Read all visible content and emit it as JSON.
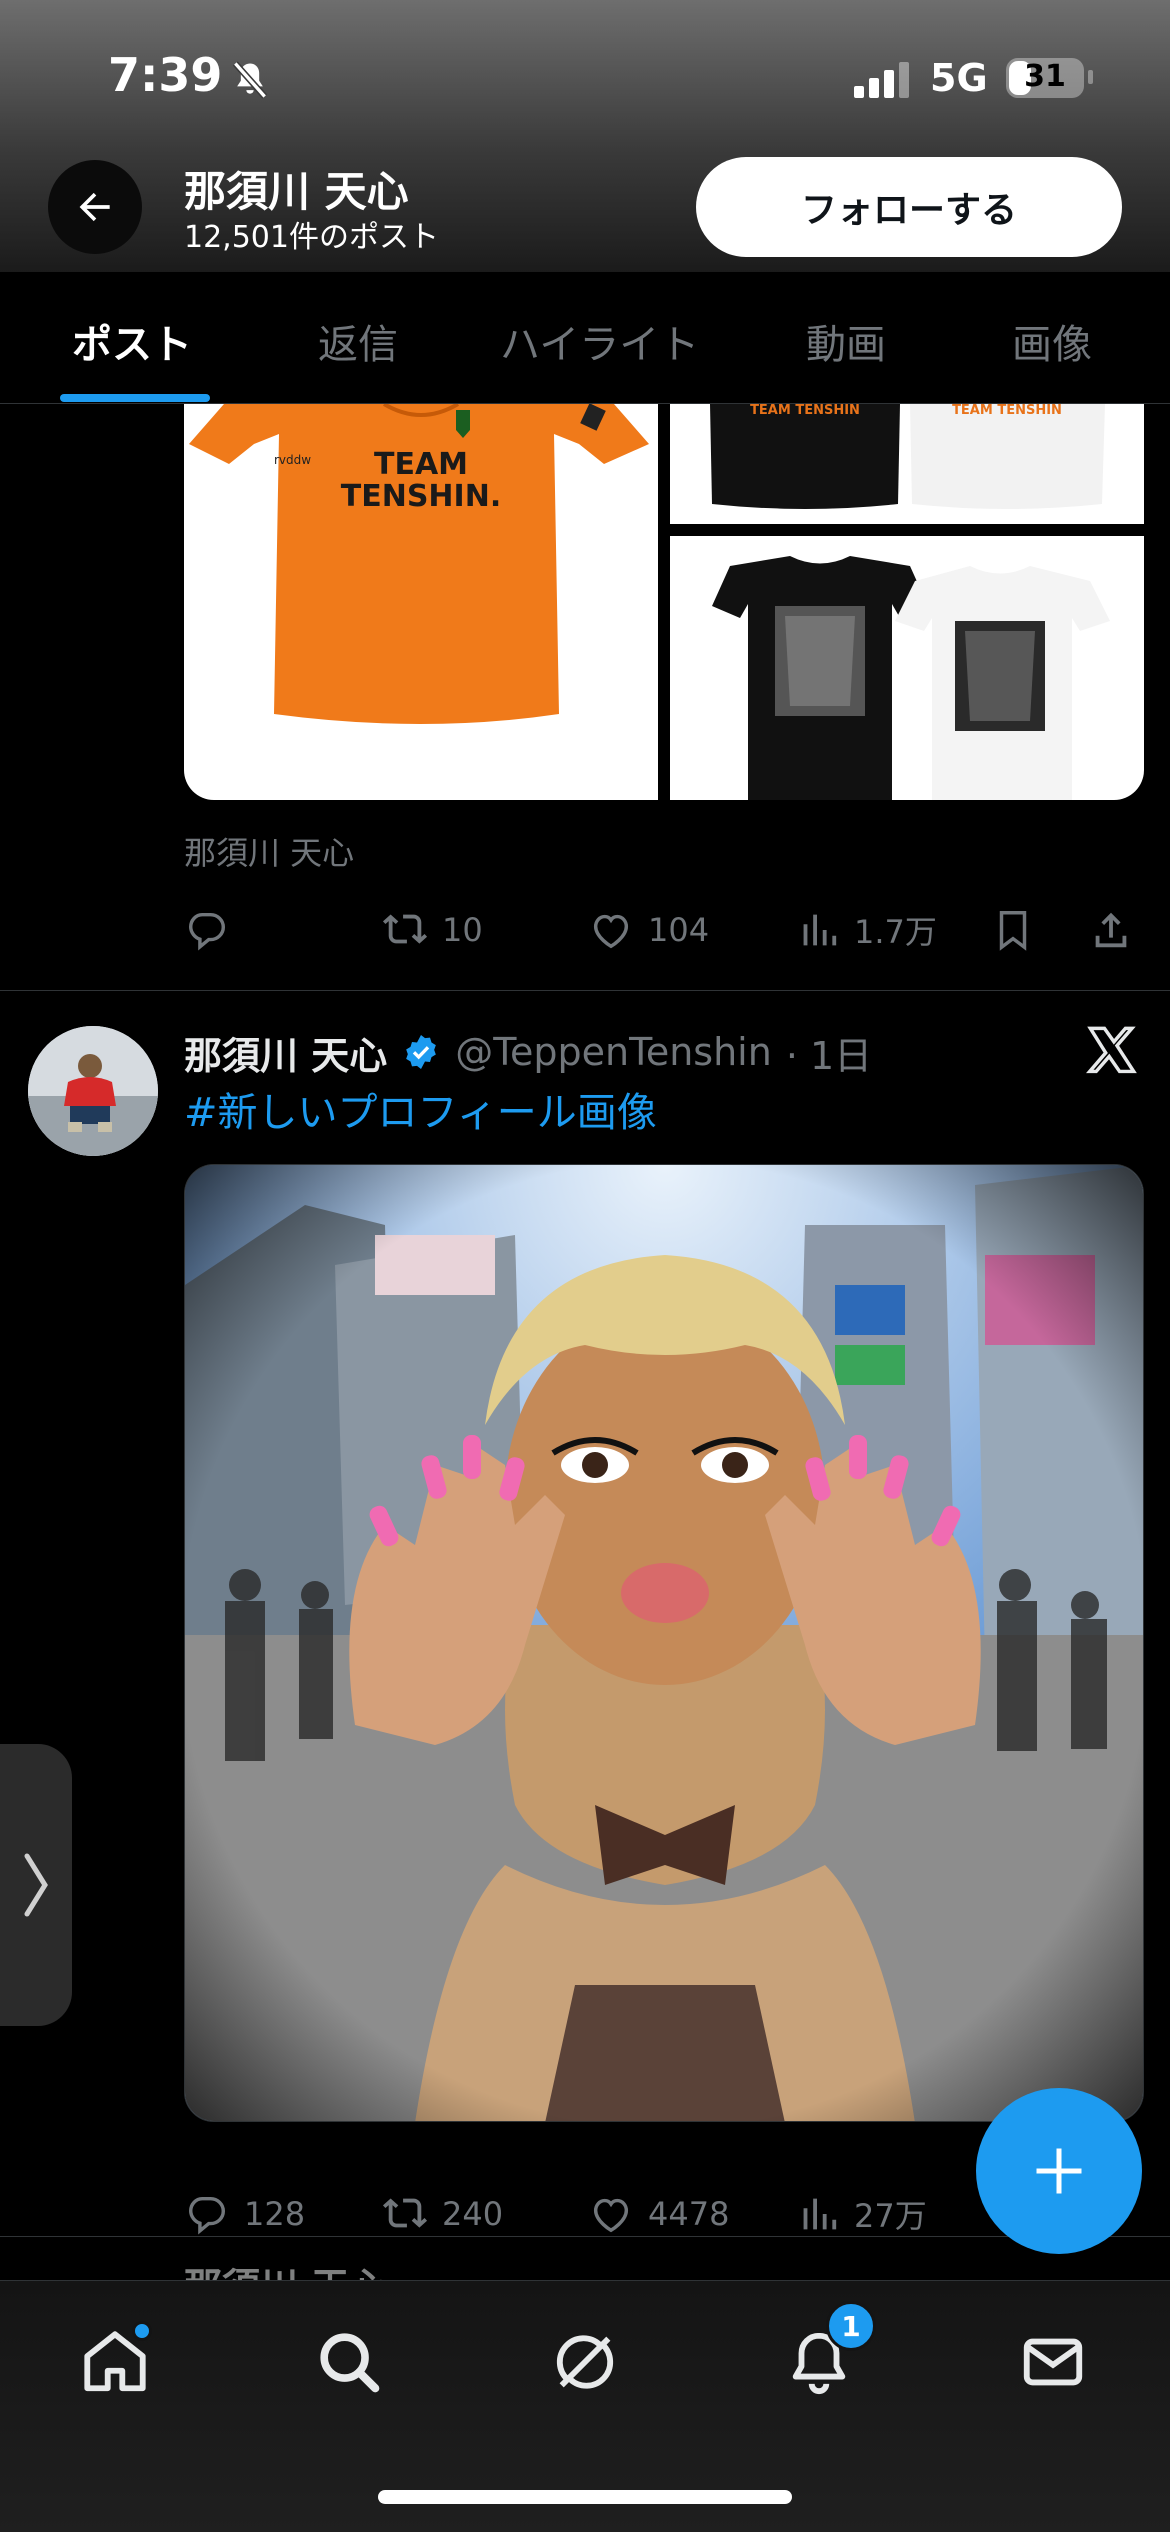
{
  "status_bar": {
    "time": "7:39",
    "network": "5G",
    "battery": "31",
    "battery_level": 0.31
  },
  "header": {
    "name": "那須川 天心",
    "post_count": "12,501件のポスト",
    "follow_label": "フォローする"
  },
  "tabs": [
    {
      "label": "ポスト",
      "active": true
    },
    {
      "label": "返信",
      "active": false
    },
    {
      "label": "ハイライト",
      "active": false
    },
    {
      "label": "動画",
      "active": false
    },
    {
      "label": "画像",
      "active": false
    }
  ],
  "post1": {
    "media_texts": {
      "jersey": "TEAM\nTENSHIN.",
      "brand": "rvddw",
      "shirt_print": "TEAM TENSHIN"
    },
    "source_name": "那須川 天心",
    "actions": {
      "replies": "",
      "reposts": "10",
      "likes": "104",
      "views": "1.7万"
    }
  },
  "post2": {
    "name": "那須川 天心",
    "handle": "@TeppenTenshin",
    "time": "· 1日",
    "hashtag": "#新しいプロフィール画像",
    "actions": {
      "replies": "128",
      "reposts": "240",
      "likes": "4478",
      "views": "27万"
    }
  },
  "next_post_peek": {
    "name": "那須川 天心"
  },
  "nav": {
    "items": [
      "home-icon",
      "search-icon",
      "grok-icon",
      "notifications-icon",
      "messages-icon"
    ],
    "notifications_badge": "1"
  },
  "colors": {
    "accent": "#1d9bf0",
    "background": "#000000",
    "muted": "#71767b"
  }
}
